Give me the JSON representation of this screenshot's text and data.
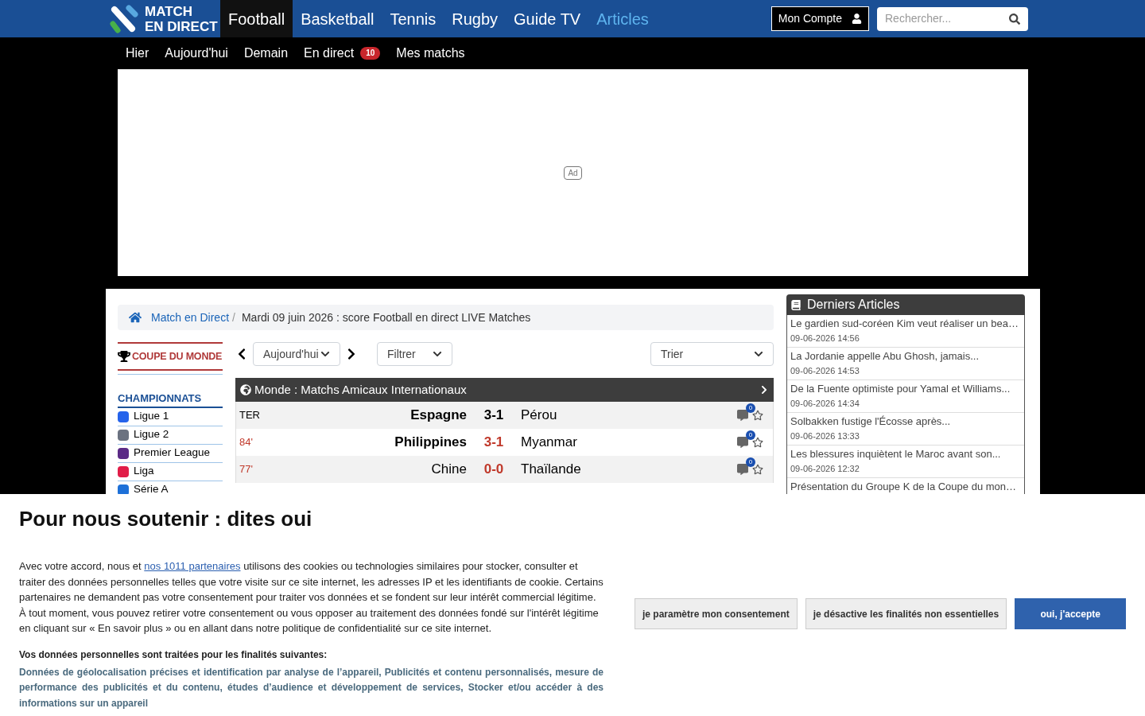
{
  "logo": {
    "line1": "MATCH",
    "line2": "EN DIRECT"
  },
  "nav": [
    {
      "label": "Football",
      "selected": true,
      "kind": "tab"
    },
    {
      "label": "Basketball",
      "selected": false,
      "kind": "tab"
    },
    {
      "label": "Tennis",
      "selected": false,
      "kind": "tab"
    },
    {
      "label": "Rugby",
      "selected": false,
      "kind": "tab"
    },
    {
      "label": "Guide TV",
      "selected": false,
      "kind": "tab"
    },
    {
      "label": "Articles",
      "selected": false,
      "kind": "highlight"
    }
  ],
  "account": {
    "label": "Mon Compte"
  },
  "search": {
    "placeholder": "Rechercher..."
  },
  "subnav": [
    {
      "label": "Hier"
    },
    {
      "label": "Aujourd'hui"
    },
    {
      "label": "Demain"
    },
    {
      "label": "En direct",
      "badge": "10"
    },
    {
      "label": "Mes matchs"
    }
  ],
  "ad": {
    "label": "Ad"
  },
  "breadcrumb": {
    "link": "Match en Direct",
    "separator": "/",
    "current": "Mardi 09 juin 2026 : score Football en direct LIVE Matches"
  },
  "sidebar": {
    "featured": "COUPE DU MONDE",
    "heading": "CHAMPIONNATS",
    "items": [
      {
        "label": "Ligue 1",
        "color": "#2563eb"
      },
      {
        "label": "Ligue 2",
        "color": "#6b7280"
      },
      {
        "label": "Premier League",
        "color": "#5b2a86"
      },
      {
        "label": "Liga",
        "color": "#e11d48"
      },
      {
        "label": "Série A",
        "color": "#1d70d8"
      }
    ]
  },
  "toolbar": {
    "day": "Aujourd'hui",
    "filter": "Filtrer",
    "sort": "Trier"
  },
  "competition": {
    "title": "Monde : Matchs Amicaux Internationaux",
    "matches": [
      {
        "status": "TER",
        "live": false,
        "home": "Espagne",
        "score": "3-1",
        "away": "Pérou",
        "home_bold": true,
        "comments": "0"
      },
      {
        "status": "84'",
        "live": true,
        "home": "Philippines",
        "score": "3-1",
        "away": "Myanmar",
        "home_bold": true,
        "comments": "0"
      },
      {
        "status": "77'",
        "live": true,
        "home": "Chine",
        "score": "0-0",
        "away": "Thaïlande",
        "home_bold": false,
        "comments": "0"
      }
    ]
  },
  "articles": {
    "title": "Derniers Articles",
    "items": [
      {
        "title": "Le gardien sud-coréen Kim veut réaliser un bea…",
        "date": "09-06-2026 14:56"
      },
      {
        "title": "La Jordanie appelle Abu Ghosh, jamais...",
        "date": "09-06-2026 14:53"
      },
      {
        "title": "De la Fuente optimiste pour Yamal et Williams...",
        "date": "09-06-2026 14:34"
      },
      {
        "title": "Solbakken fustige l'Écosse après...",
        "date": "09-06-2026 13:33"
      },
      {
        "title": "Les blessures inquiètent le Maroc avant son...",
        "date": "09-06-2026 12:32"
      },
      {
        "title": "Présentation du Groupe K de la Coupe du mon…"
      }
    ]
  },
  "consent": {
    "title": "Pour nous soutenir : dites oui",
    "text_before": "Avec votre accord, nous et",
    "link": "nos 1011 partenaires",
    "text_after": "utilisons des cookies ou technologies similaires pour stocker, consulter et traiter des données personnelles telles que votre visite sur ce site internet, les adresses IP et les identifiants de cookie. Certains partenaires ne demandent pas votre consentement pour traiter vos données et se fondent sur leur intérêt commercial légitime. À tout moment, vous pouvez retirer votre consentement ou vous opposer au traitement des données fondé sur l'intérêt légitime en cliquant sur « En savoir plus » ou en allant dans notre politique de confidentialité sur ce site internet.",
    "purposes_title": "Vos données personnelles sont traitées pour les finalités suivantes:",
    "purposes": "Données de géolocalisation précises et identification par analyse de l’appareil, Publicités et contenu personnalisés, mesure de performance des publicités et du contenu, études d’audience et développement de services, Stocker et/ou accéder à des informations sur un appareil",
    "buttons": [
      {
        "label": "je paramètre mon consentement",
        "kind": "secondary"
      },
      {
        "label": "je désactive les finalités non essentielles",
        "kind": "secondary"
      },
      {
        "label": "oui, j'accepte",
        "kind": "primary"
      }
    ]
  }
}
